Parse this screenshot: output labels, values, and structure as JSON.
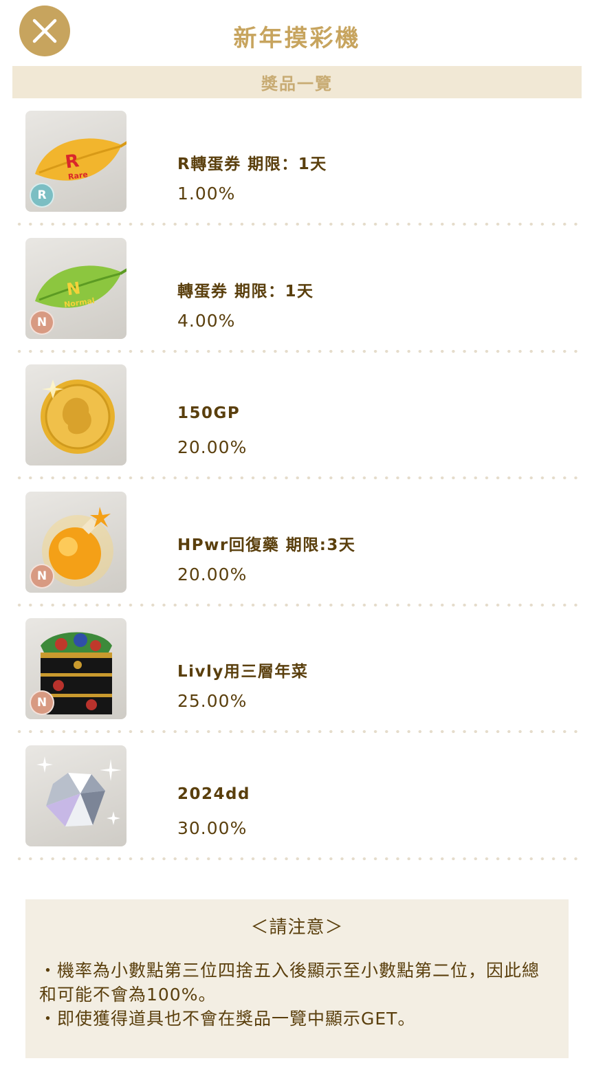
{
  "header": {
    "title": "新年摸彩機",
    "close_icon": "close-icon",
    "accent_color": "#c7a45e"
  },
  "section": {
    "title": "獎品一覽"
  },
  "prizes": [
    {
      "name": "R轉蛋券 期限：1天",
      "rate": "1.00%",
      "rarity": "R",
      "icon": "rare-leaf-ticket-icon"
    },
    {
      "name": "轉蛋券 期限：1天",
      "rate": "4.00%",
      "rarity": "N",
      "icon": "normal-leaf-ticket-icon"
    },
    {
      "name": "150GP",
      "rate": "20.00%",
      "rarity": "",
      "icon": "gold-coin-icon"
    },
    {
      "name": "HPwr回復藥 期限:3天",
      "rate": "20.00%",
      "rarity": "N",
      "icon": "potion-flask-icon"
    },
    {
      "name": "Livly用三層年菜",
      "rate": "25.00%",
      "rarity": "N",
      "icon": "osechi-box-icon"
    },
    {
      "name": "2024dd",
      "rate": "30.00%",
      "rarity": "",
      "icon": "diamond-icon"
    }
  ],
  "notice": {
    "title": "＜請注意＞",
    "lines": [
      "・機率為小數點第三位四捨五入後顯示至小數點第二位，因此總和可能不會為100%。",
      "・即使獲得道具也不會在獎品一覽中顯示GET。"
    ]
  }
}
